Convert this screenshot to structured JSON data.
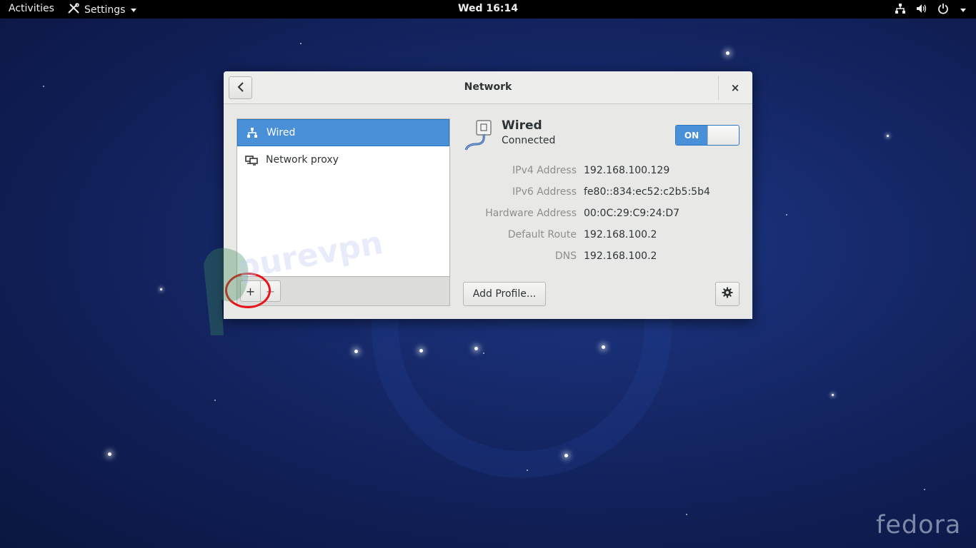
{
  "topbar": {
    "activities": "Activities",
    "app_menu": "Settings",
    "clock": "Wed 16:14",
    "tray_icons": [
      "network-icon",
      "volume-icon",
      "power-icon"
    ]
  },
  "window": {
    "title": "Network",
    "back_icon": "chevron-left-icon",
    "close_label": "×"
  },
  "sidebar": {
    "items": [
      {
        "label": "Wired",
        "icon": "wired-network-icon",
        "selected": true
      },
      {
        "label": "Network proxy",
        "icon": "network-proxy-icon",
        "selected": false
      }
    ],
    "add_label": "+",
    "remove_label": "−"
  },
  "device": {
    "name": "Wired",
    "status": "Connected",
    "switch_label": "ON",
    "switch_on": true
  },
  "details": [
    {
      "label": "IPv4 Address",
      "value": "192.168.100.129"
    },
    {
      "label": "IPv6 Address",
      "value": "fe80::834:ec52:c2b5:5b4"
    },
    {
      "label": "Hardware Address",
      "value": "00:0C:29:C9:24:D7"
    },
    {
      "label": "Default Route",
      "value": "192.168.100.2"
    },
    {
      "label": "DNS",
      "value": "192.168.100.2"
    }
  ],
  "buttons": {
    "add_profile": "Add Profile...",
    "settings_icon": "gear-icon"
  },
  "watermarks": {
    "purevpn": "purevpn",
    "fedora": "fedora"
  },
  "colors": {
    "accent": "#4a90d9",
    "annotation": "#e8141a",
    "desktop": "#16296b"
  }
}
